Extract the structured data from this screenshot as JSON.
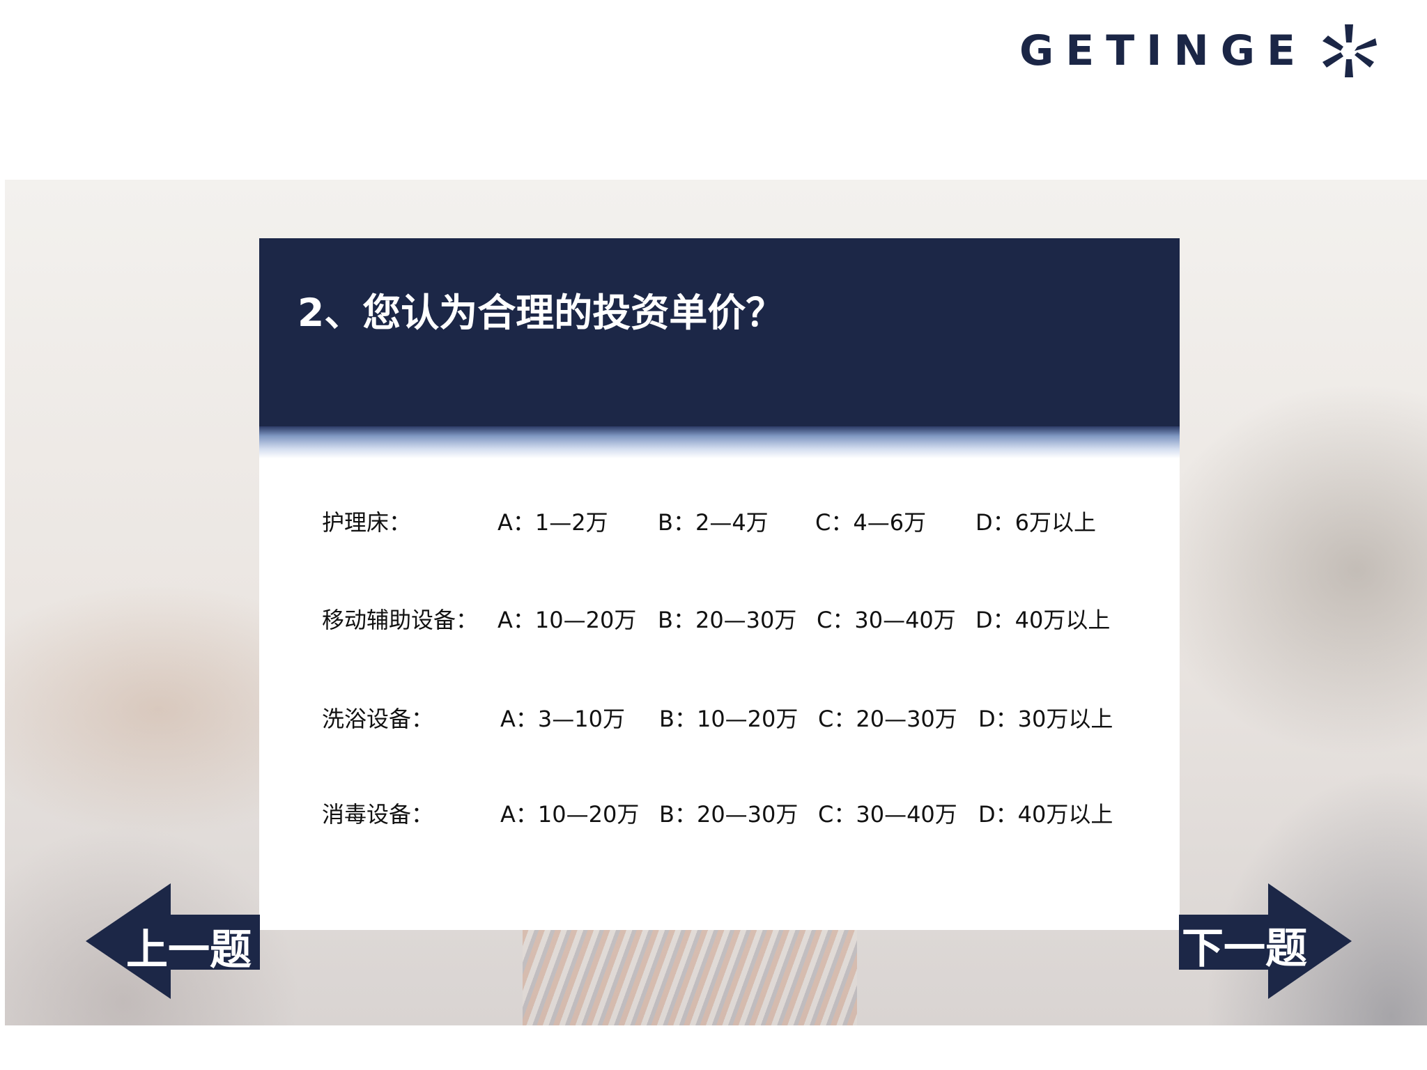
{
  "brand": {
    "name": "GETINGE",
    "color": "#1b2646"
  },
  "question": {
    "title": "2、您认为合理的投资单价？"
  },
  "rows": [
    {
      "category": "护理床：",
      "a": "A：1—2万",
      "b": "B：2—4万",
      "c": "C：4—6万",
      "d": "D：6万以上"
    },
    {
      "category": "移动辅助设备：",
      "a": "A：10—20万",
      "b": "B：20—30万",
      "c": "C：30—40万",
      "d": "D：40万以上"
    },
    {
      "category": "洗浴设备：",
      "a": "A：3—10万",
      "b": "B：10—20万",
      "c": "C：20—30万",
      "d": "D：30万以上"
    },
    {
      "category": "消毒设备：",
      "a": "A：10—20万",
      "b": "B：20—30万",
      "c": "C：30—40万",
      "d": "D：40万以上"
    }
  ],
  "nav": {
    "prev_label": "上一题",
    "next_label": "下一题"
  },
  "colors": {
    "header_bg": "#1c2747",
    "text": "#111111",
    "card_bg": "#ffffff"
  }
}
